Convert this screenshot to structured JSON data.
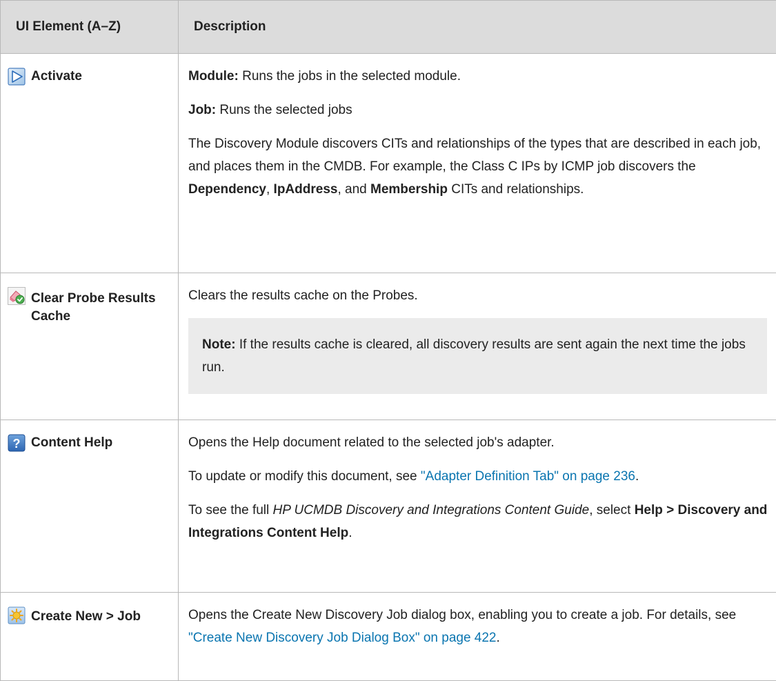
{
  "header": {
    "col1": "UI Element (A–Z)",
    "col2": "Description"
  },
  "rows": {
    "activate": {
      "name": "Activate",
      "icon": "play-icon",
      "module_label": "Module:",
      "module_text": "Runs the jobs in the selected module.",
      "job_label": "Job:",
      "job_text": "Runs the selected jobs",
      "body_1": "The Discovery Module discovers CITs and relationships of the types that are described in each job, and places them in the CMDB. For example, the Class C IPs by ICMP job discovers the ",
      "bold_1": "Dependency",
      "sep_1": ", ",
      "bold_2": "IpAddress",
      "sep_2": ", and ",
      "bold_3": "Membership",
      "body_2": " CITs and relationships."
    },
    "clear_cache": {
      "name": "Clear Probe Results Cache",
      "icon": "eraser-check-icon",
      "text": "Clears the results cache on the Probes.",
      "note_label": "Note:",
      "note_text": " If the results cache is cleared, all discovery results are sent again the next time the jobs run."
    },
    "content_help": {
      "name": "Content Help",
      "icon": "help-question-icon",
      "text": "Opens the Help document related to the selected job's adapter.",
      "update_text": "To update or modify this document, see ",
      "update_link": "\"Adapter Definition Tab\" on page 236",
      "update_end": ".",
      "guide_text_1": "To see the full ",
      "guide_title": "HP UCMDB Discovery and Integrations Content Guide",
      "guide_text_2": ", select ",
      "guide_menu": "Help > Discovery and Integrations Content Help",
      "guide_end": "."
    },
    "create_job": {
      "name": "Create New > Job",
      "icon": "new-star-icon",
      "text": "Opens the Create New Discovery Job dialog box, enabling you to create a job. For details, see ",
      "link": "\"Create New Discovery Job Dialog Box\" on page 422",
      "end": "."
    }
  },
  "colors": {
    "link": "#0a75b0",
    "header_bg": "#dcdcdc",
    "note_bg": "#ebebeb",
    "border": "#b8b8b8"
  }
}
